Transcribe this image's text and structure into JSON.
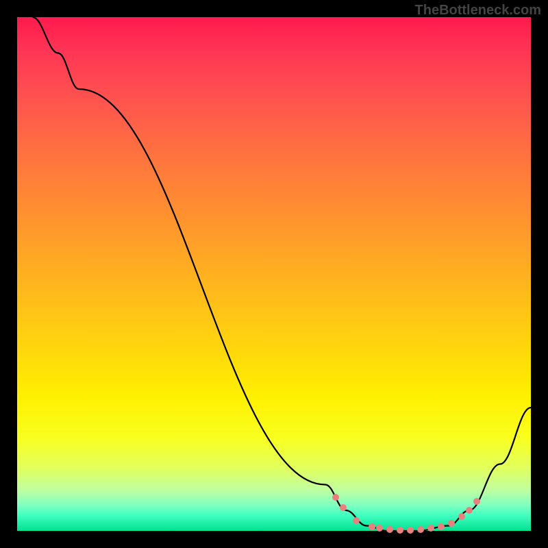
{
  "watermark": "TheBottleneck.com",
  "chart_data": {
    "type": "line",
    "title": "",
    "xlabel": "",
    "ylabel": "",
    "xlim": [
      0,
      100
    ],
    "ylim": [
      0,
      100
    ],
    "background_gradient": {
      "direction": "vertical",
      "stops": [
        {
          "pos": 0,
          "color": "#ff1a4d"
        },
        {
          "pos": 50,
          "color": "#ffb020"
        },
        {
          "pos": 80,
          "color": "#fff000"
        },
        {
          "pos": 100,
          "color": "#00e090"
        }
      ]
    },
    "series": [
      {
        "name": "curve",
        "color": "#000000",
        "points": [
          {
            "x": 3,
            "y": 100
          },
          {
            "x": 8,
            "y": 93
          },
          {
            "x": 12,
            "y": 86
          },
          {
            "x": 60,
            "y": 9
          },
          {
            "x": 64,
            "y": 4
          },
          {
            "x": 68,
            "y": 1
          },
          {
            "x": 72,
            "y": 0
          },
          {
            "x": 78,
            "y": 0
          },
          {
            "x": 84,
            "y": 1
          },
          {
            "x": 88,
            "y": 4
          },
          {
            "x": 94,
            "y": 13
          },
          {
            "x": 100,
            "y": 24
          }
        ]
      }
    ],
    "highlight_dots": {
      "color": "#e98080",
      "points": [
        {
          "x": 62,
          "y": 6.5
        },
        {
          "x": 63.5,
          "y": 4.5
        },
        {
          "x": 66,
          "y": 2
        },
        {
          "x": 69,
          "y": 0.8
        },
        {
          "x": 70.5,
          "y": 0.5
        },
        {
          "x": 72.5,
          "y": 0.3
        },
        {
          "x": 74.5,
          "y": 0.2
        },
        {
          "x": 76.5,
          "y": 0.2
        },
        {
          "x": 78.5,
          "y": 0.3
        },
        {
          "x": 80.5,
          "y": 0.5
        },
        {
          "x": 82.5,
          "y": 0.8
        },
        {
          "x": 84.5,
          "y": 1.5
        },
        {
          "x": 86.5,
          "y": 2.8
        },
        {
          "x": 88,
          "y": 4
        },
        {
          "x": 89.5,
          "y": 5.8
        }
      ]
    }
  }
}
